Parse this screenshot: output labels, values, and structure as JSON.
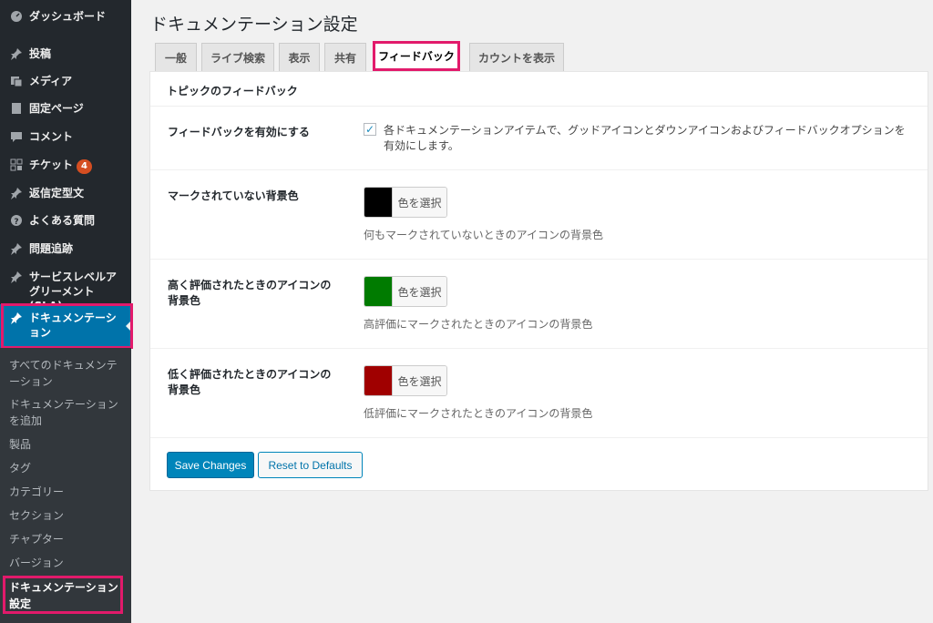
{
  "sidebar": {
    "items": [
      {
        "label": "ダッシュボード",
        "icon": "dashboard-icon"
      },
      {
        "label": "投稿",
        "icon": "pin-icon"
      },
      {
        "label": "メディア",
        "icon": "media-icon"
      },
      {
        "label": "固定ページ",
        "icon": "page-icon"
      },
      {
        "label": "コメント",
        "icon": "comment-icon"
      },
      {
        "label": "チケット",
        "icon": "ticket-icon",
        "badge": "4"
      },
      {
        "label": "返信定型文",
        "icon": "pin-icon"
      },
      {
        "label": "よくある質問",
        "icon": "help-icon"
      },
      {
        "label": "問題追跡",
        "icon": "pin-icon"
      },
      {
        "label": "サービスレベルアグリーメント(SLA)",
        "icon": "pin-icon"
      },
      {
        "label": "ドキュメンテーション",
        "icon": "pin-icon"
      }
    ],
    "submenu": [
      "すべてのドキュメンテーション",
      "ドキュメンテーションを追加",
      "製品",
      "タグ",
      "カテゴリー",
      "セクション",
      "チャプター",
      "バージョン",
      "ドキュメンテーション設定"
    ]
  },
  "page": {
    "title": "ドキュメンテーション設定"
  },
  "tabs": [
    "一般",
    "ライブ検索",
    "表示",
    "共有",
    "フィードバック",
    "カウントを表示"
  ],
  "section": {
    "title": "トピックのフィードバック",
    "rows": [
      {
        "label": "フィードバックを有効にする",
        "checkbox_checked": true,
        "checkbox_text": "各ドキュメンテーションアイテムで、グッドアイコンとダウンアイコンおよびフィードバックオプションを有効にします。"
      },
      {
        "label": "マークされていない背景色",
        "swatch_color": "#000000",
        "button": "色を選択",
        "description": "何もマークされていないときのアイコンの背景色"
      },
      {
        "label": "高く評価されたときのアイコンの背景色",
        "swatch_color": "#007b00",
        "button": "色を選択",
        "description": "高評価にマークされたときのアイコンの背景色"
      },
      {
        "label": "低く評価されたときのアイコンの背景色",
        "swatch_color": "#a00000",
        "button": "色を選択",
        "description": "低評価にマークされたときのアイコンの背景色"
      }
    ]
  },
  "actions": {
    "save": "Save Changes",
    "reset": "Reset to Defaults"
  },
  "colors": {
    "sidebar_bg": "#23282d",
    "submenu_bg": "#32373c",
    "active_blue": "#0073aa",
    "highlight": "#e21a6b",
    "primary_button": "#0085ba"
  }
}
